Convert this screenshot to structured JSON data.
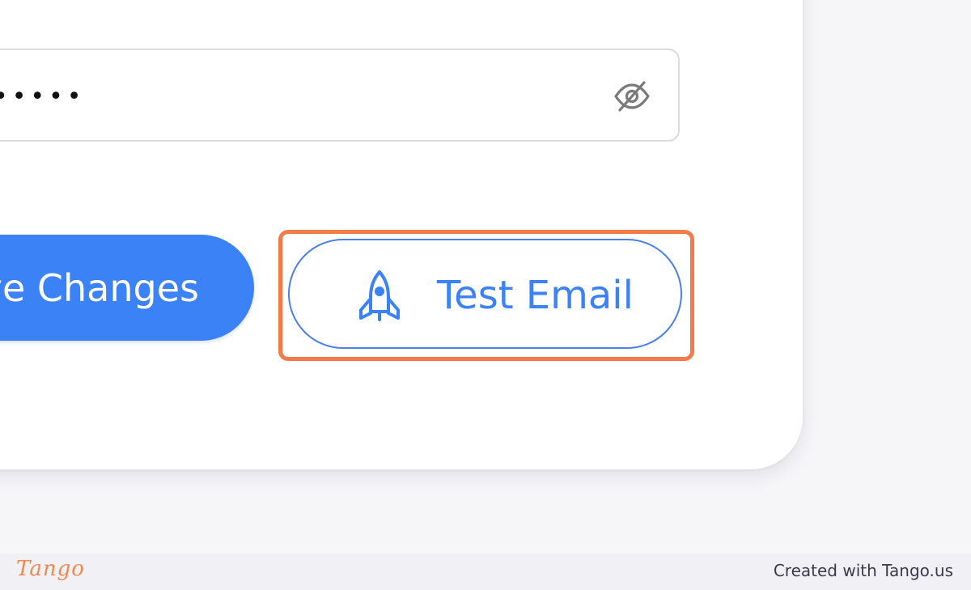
{
  "form": {
    "password_value": "•••••",
    "password_visibility_toggle_icon": "eye-slash-icon",
    "save_button_label": "Save Changes",
    "test_email_button_label": "Test Email",
    "test_email_icon": "rocket-icon"
  },
  "highlight": {
    "target": "test-email-button",
    "color": "#f47a48"
  },
  "footer": {
    "logo_text": "Tango",
    "credit_text": "Created with Tango.us"
  },
  "colors": {
    "primary": "#3b82f6",
    "page_background": "#f6f6f9",
    "card_background": "#ffffff",
    "footer_background": "#f1f0f5"
  }
}
